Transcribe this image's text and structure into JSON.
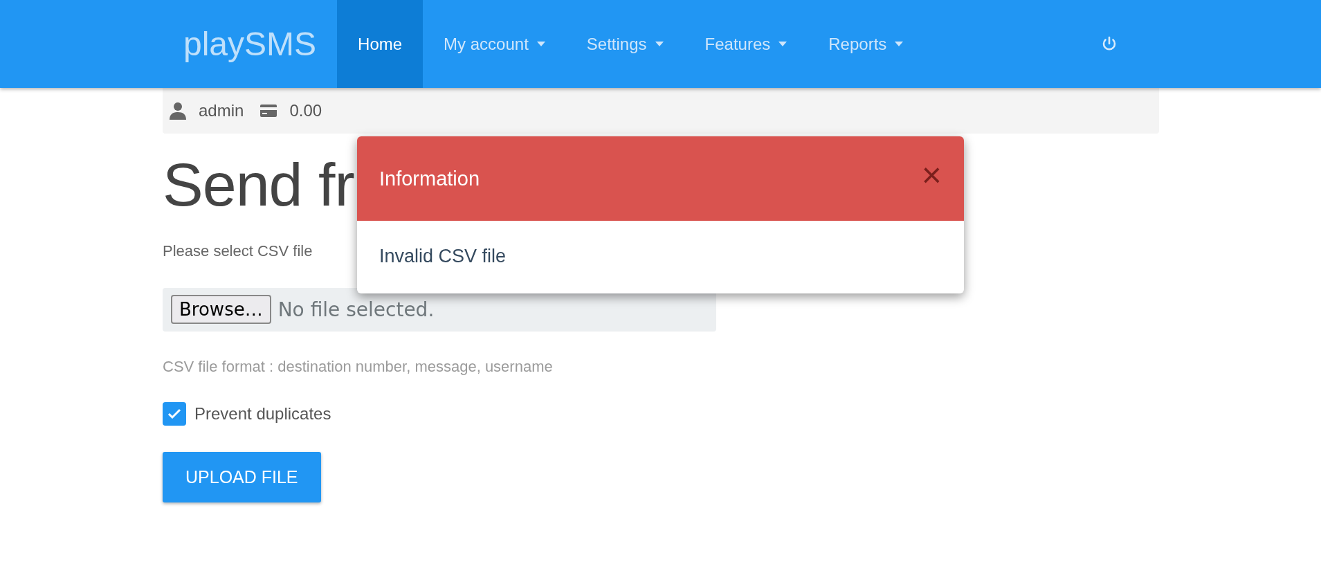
{
  "navbar": {
    "brand": "playSMS",
    "items": [
      {
        "label": "Home",
        "selected": true,
        "dropdown": false
      },
      {
        "label": "My account",
        "selected": false,
        "dropdown": true
      },
      {
        "label": "Settings",
        "selected": false,
        "dropdown": true
      },
      {
        "label": "Features",
        "selected": false,
        "dropdown": true
      },
      {
        "label": "Reports",
        "selected": false,
        "dropdown": true
      }
    ]
  },
  "user_bar": {
    "username": "admin",
    "credit": "0.00"
  },
  "page": {
    "heading": "Send fr",
    "file_label": "Please select CSV file",
    "browse_button": "Browse…",
    "file_status": "No file selected.",
    "hint": "CSV file format : destination number, message, username",
    "prevent_duplicates": {
      "label": "Prevent duplicates",
      "checked": true
    },
    "upload_button": "UPLOAD FILE"
  },
  "modal": {
    "title": "Information",
    "close": "×",
    "message": "Invalid CSV file"
  }
}
